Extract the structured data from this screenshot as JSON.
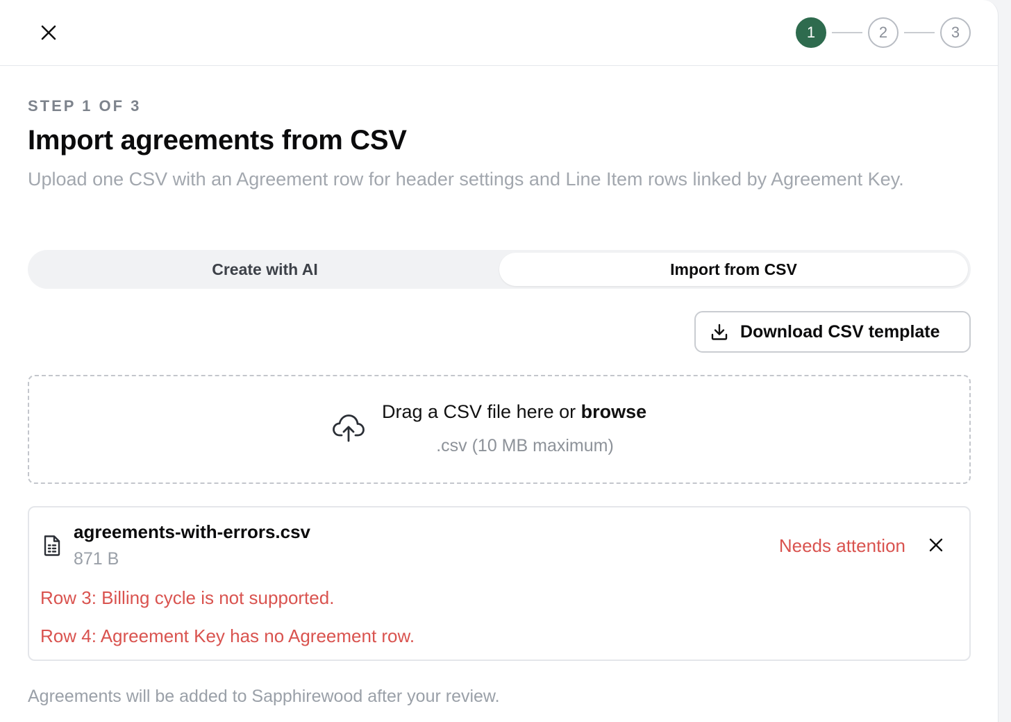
{
  "header": {
    "close_icon": "close-icon",
    "steps": [
      {
        "label": "1",
        "state": "active"
      },
      {
        "label": "2",
        "state": "inactive"
      },
      {
        "label": "3",
        "state": "inactive"
      }
    ],
    "active_color": "#2e6b4e"
  },
  "main": {
    "step_label": "STEP 1 OF 3",
    "title": "Import agreements from CSV",
    "subtitle": "Upload one CSV with an Agreement row for header settings and Line Item rows linked by Agreement Key.",
    "tabs": [
      {
        "label": "Create with AI",
        "selected": false
      },
      {
        "label": "Import from CSV",
        "selected": true
      }
    ],
    "download_button": {
      "label": "Download CSV template",
      "icon": "download-icon"
    },
    "dropzone": {
      "icon": "cloud-upload-icon",
      "text": "Drag a CSV file here or ",
      "link": "browse",
      "hint": ".csv (10 MB maximum)"
    },
    "file": {
      "icon": "file-spreadsheet-icon",
      "name": "agreements-with-errors.csv",
      "size": "871 B",
      "status": "Needs attention",
      "status_color": "#d9534f",
      "errors": [
        "Row 3: Billing cycle is not supported.",
        "Row 4: Agreement Key has no Agreement row."
      ]
    },
    "footnote": "Agreements will be added to Sapphirewood after your review."
  }
}
